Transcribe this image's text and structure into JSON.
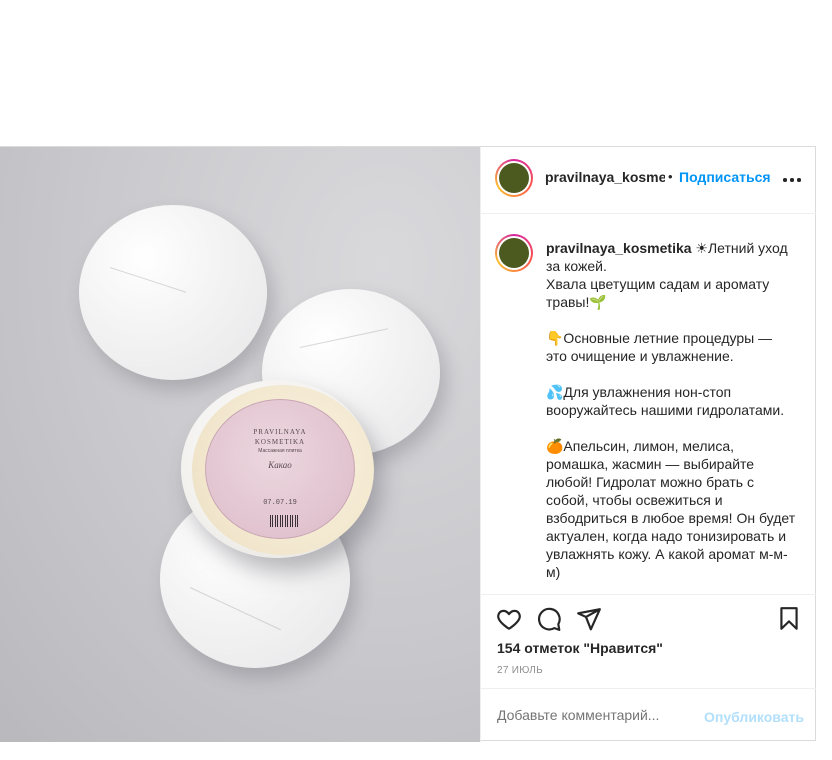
{
  "post": {
    "username": "pravilnaya_kosmetika",
    "header_username_display": "pravilnaya_kosmeti",
    "dot_separator": "•",
    "follow_label": "Подписаться",
    "photo_label": {
      "brand_line1": "PRAVILNAYA",
      "brand_line2": "KOSMETIKA",
      "product_type": "Массажная плитка",
      "product_name": "Какао",
      "date_stamp": "07.07.19"
    },
    "caption_lines": [
      "Летний уход",
      "за кожей.",
      "Хвала цветущим садам и аромату травы!🌱",
      "",
      "👇Основные летние процедуры — это очищение и увлажнение.",
      "",
      "💦Для увлажнения нон-стоп вооружайтесь нашими гидролатами.",
      "",
      "🍊Апельсин, лимон, мелиса, ромашка, жасмин — выбирайте любой! Гидролат можно брать с собой, чтобы освежиться и взбодриться в любое время! Он будет актуален, когда надо тонизировать и увлажнять кожу. А какой аромат м-м-м)"
    ],
    "caption_sun_emoji": "☀",
    "likes_text": "154 отметок \"Нравится\"",
    "date_text": "27 ИЮЛЬ",
    "comment_placeholder": "Добавьте комментарий...",
    "publish_label": "Опубликовать"
  },
  "icons": {
    "like": "heart-outline-icon",
    "comment": "speech-bubble-icon",
    "share": "paper-plane-icon",
    "save": "bookmark-icon",
    "more": "more-options-icon"
  },
  "colors": {
    "accent": "#0095f6",
    "publish_disabled": "#b2dffc",
    "muted": "#8e8e8e",
    "text": "#262626",
    "avatar": "#4c5a1f"
  }
}
